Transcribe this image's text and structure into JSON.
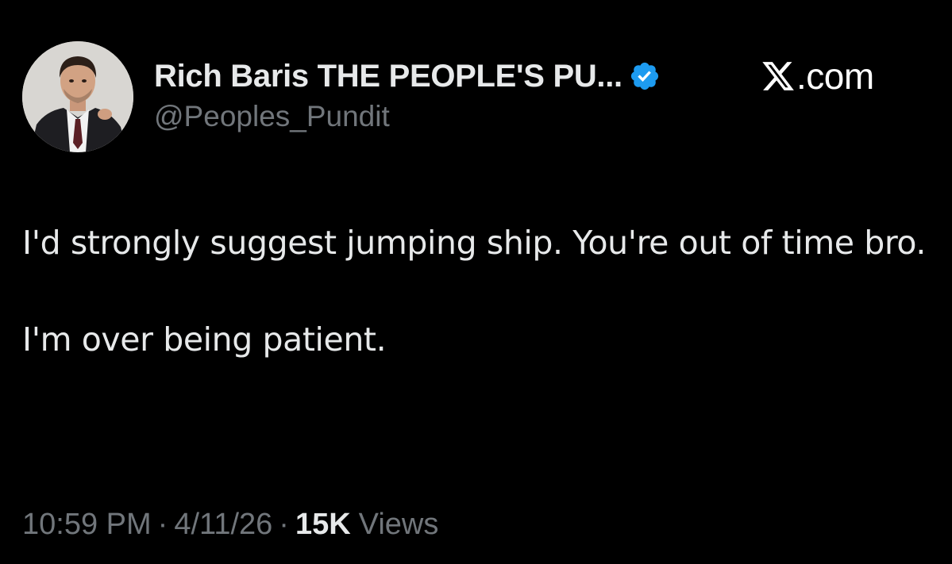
{
  "author": {
    "display_name": "Rich Baris THE PEOPLE'S PU...",
    "handle": "@Peoples_Pundit",
    "verified": true,
    "verified_color": "#1d9bf0"
  },
  "brand": {
    "icon": "x-logo-icon",
    "text": ".com"
  },
  "tweet": {
    "line1": "I'd strongly suggest jumping ship. You're out of time bro.",
    "line2": "I'm over being patient."
  },
  "meta": {
    "time": "10:59 PM",
    "separator": "·",
    "date": "4/11/26",
    "views_count": "15K",
    "views_label": "Views"
  }
}
